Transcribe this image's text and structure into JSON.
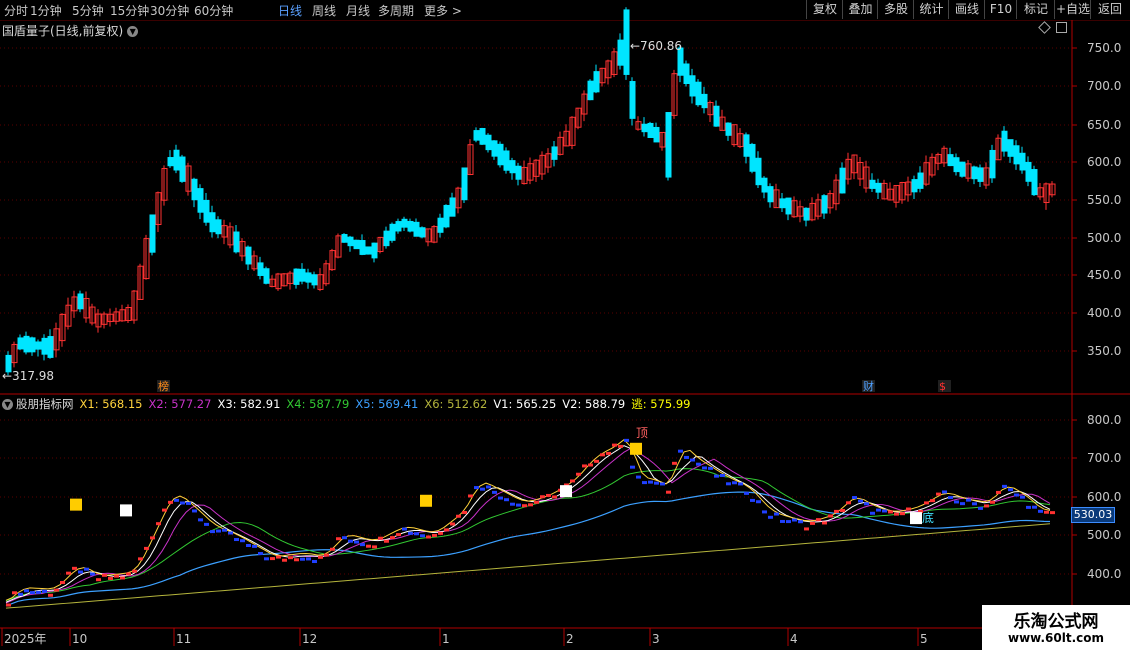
{
  "periods": [
    {
      "label": "分时",
      "active": false
    },
    {
      "label": "1分钟",
      "active": false
    },
    {
      "label": "5分钟",
      "active": false
    },
    {
      "label": "15分钟",
      "active": false
    },
    {
      "label": "30分钟",
      "active": false
    },
    {
      "label": "60分钟",
      "active": false
    },
    {
      "label": "日线",
      "active": true
    },
    {
      "label": "周线",
      "active": false
    },
    {
      "label": "月线",
      "active": false
    },
    {
      "label": "多周期",
      "active": false
    },
    {
      "label": "更多 >",
      "active": false
    }
  ],
  "toolbar_right": [
    "复权",
    "叠加",
    "多股",
    "统计",
    "画线",
    "F10",
    "标记",
    "+自选",
    "返回"
  ],
  "main_chart": {
    "title": "国盾量子(日线,前复权)",
    "high_label": "760.86",
    "low_label": "317.98",
    "y_ticks": [
      "750.0",
      "700.0",
      "650.0",
      "600.0",
      "550.0",
      "500.0",
      "450.0",
      "400.0",
      "350.0"
    ],
    "markers": [
      {
        "text": "榜",
        "color": "#ff8c1a"
      },
      {
        "text": "财",
        "color": "#4ea0ff"
      },
      {
        "text": "$",
        "color": "#ff3030"
      }
    ]
  },
  "indicator": {
    "name": "股朋指标网",
    "values": [
      {
        "label": "X1: 568.15",
        "color": "#ffd23c"
      },
      {
        "label": "X2: 577.27",
        "color": "#c832c8"
      },
      {
        "label": "X3: 582.91",
        "color": "#ffffff"
      },
      {
        "label": "X4: 587.79",
        "color": "#32c832"
      },
      {
        "label": "X5: 569.41",
        "color": "#3ca0ff"
      },
      {
        "label": "X6: 512.62",
        "color": "#b4b43c"
      },
      {
        "label": "V1: 565.25",
        "color": "#ffffff"
      },
      {
        "label": "V2: 588.79",
        "color": "#ffffff"
      },
      {
        "label": "逃: 575.99",
        "color": "#ffff00"
      }
    ],
    "y_ticks": [
      "800.0",
      "700.0",
      "600.0",
      "500.0",
      "400.0"
    ],
    "current_price": "530.03",
    "signals": [
      "顶",
      "底"
    ]
  },
  "date_axis": [
    "2025年",
    "10",
    "11",
    "12",
    "1",
    "2",
    "3",
    "4",
    "5"
  ],
  "colors": {
    "up": "#ff3232",
    "down": "#00e5ff",
    "grid": "#5a0000",
    "axis": "#b00000"
  },
  "watermark": {
    "title": "乐淘公式网",
    "url": "www.60lt.com"
  }
}
